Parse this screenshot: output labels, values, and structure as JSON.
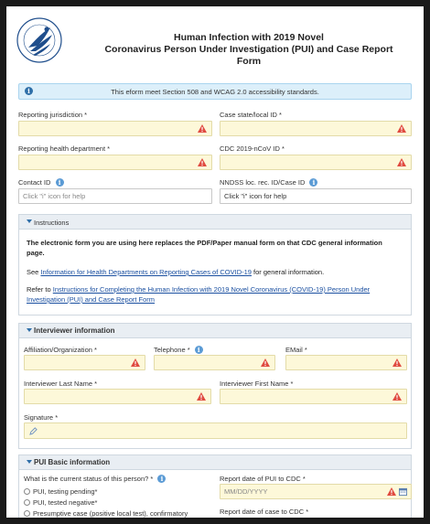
{
  "header": {
    "logo_icon": "hhs-eagle-seal-icon",
    "title_line1": "Human Infection with 2019 Novel",
    "title_line2": "Coronavirus Person Under Investigation (PUI) and Case Report",
    "title_line3": "Form"
  },
  "accessibility_notice": "This eform meet Section 508 and WCAG 2.0 accessibility standards.",
  "top_fields": {
    "reporting_jurisdiction": "Reporting jurisdiction *",
    "case_state_id": "Case state/local ID *",
    "reporting_health_department": "Reporting health department *",
    "cdc_ncov_id": "CDC 2019-nCoV ID *",
    "contact_id": "Contact ID",
    "contact_id_placeholder": "Click \"i\" icon for help",
    "nndss_id": "NNDSS loc. rec. ID/Case ID",
    "nndss_placeholder": "Click \"i\" icon for help"
  },
  "instructions": {
    "header": "Instructions",
    "intro": "The electronic form you are using here replaces the PDF/Paper manual form on that CDC general information page.",
    "see_prefix": "See ",
    "see_link": "Information for Health Departments on Reporting Cases of COVID-19",
    "see_suffix": " for general information.",
    "refer_prefix": "Refer to ",
    "refer_link": "Instructions for Completing the Human Infection with 2019 Novel Coronavirus (COVID-19) Person Under Investigation (PUI) and Case Report Form"
  },
  "interviewer": {
    "header": "Interviewer information",
    "affiliation": "Affiliation/Organization *",
    "telephone": "Telephone *",
    "email": "EMail *",
    "last_name": "Interviewer Last Name *",
    "first_name": "Interviewer First Name *",
    "signature": "Signature *"
  },
  "pui_basic": {
    "header": "PUI Basic information",
    "status_question": "What is the current status of this person? *",
    "status_options": [
      "PUI, testing pending*",
      "PUI, tested negative*",
      "Presumptive case (positive local test), confirmatory"
    ],
    "report_date_pui": "Report date of PUI to CDC *",
    "report_date_pui_placeholder": "MM/DD/YYYY",
    "report_date_case": "Report date of case to CDC *"
  },
  "colors": {
    "required_field_bg": "#fdf8d9",
    "warning_icon": "#e04a3f",
    "info_icon": "#2f6fa8",
    "link": "#1a4fa0"
  }
}
